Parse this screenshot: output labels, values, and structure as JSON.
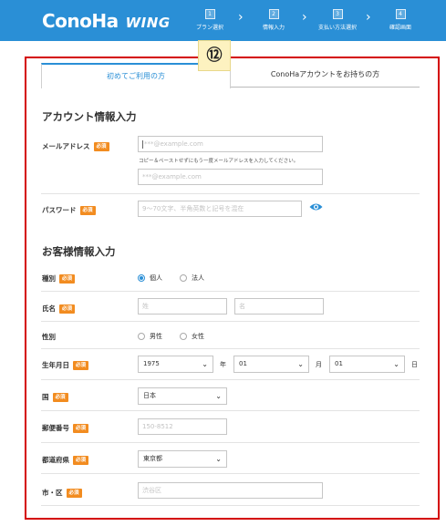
{
  "header": {
    "logo_main": "ConoHa",
    "logo_sub": "WING",
    "steps": [
      {
        "num": "1",
        "label": "プラン選択"
      },
      {
        "num": "2",
        "label": "情報入力"
      },
      {
        "num": "3",
        "label": "支払い方法選択"
      },
      {
        "num": "4",
        "label": "確認画面"
      }
    ],
    "chevron": "›"
  },
  "annotation_badge": "⑫",
  "tabs": {
    "first_time": "初めてご利用の方",
    "has_account": "ConoHaアカウントをお持ちの方"
  },
  "account_section": {
    "title": "アカウント情報入力",
    "email_label": "メールアドレス",
    "required": "必須",
    "email_placeholder": "***@example.com",
    "email_note": "コピー＆ペーストせずにもう一度メールアドレスを入力してください。",
    "email_confirm_placeholder": "***@example.com",
    "password_label": "パスワード",
    "password_placeholder": "9〜70文字、半角英数と記号を混在"
  },
  "customer_section": {
    "title": "お客様情報入力",
    "type_label": "種別",
    "type_options": [
      "個人",
      "法人"
    ],
    "name_label": "氏名",
    "last_name_placeholder": "姓",
    "first_name_placeholder": "名",
    "gender_label": "性別",
    "gender_options": [
      "男性",
      "女性"
    ],
    "birth_label": "生年月日",
    "birth_year": "1975",
    "birth_year_unit": "年",
    "birth_month": "01",
    "birth_month_unit": "月",
    "birth_day": "01",
    "birth_day_unit": "日",
    "country_label": "国",
    "country_value": "日本",
    "postal_label": "郵便番号",
    "postal_placeholder": "150-8512",
    "prefecture_label": "都道府県",
    "prefecture_value": "東京都",
    "city_label": "市・区",
    "city_placeholder": "渋谷区"
  },
  "colors": {
    "brand_blue": "#2a8fd6",
    "required_orange": "#f28c20",
    "outline_red": "#d40000"
  },
  "icons": [
    "eye-icon",
    "chevron-down-icon",
    "chevron-right-icon"
  ]
}
